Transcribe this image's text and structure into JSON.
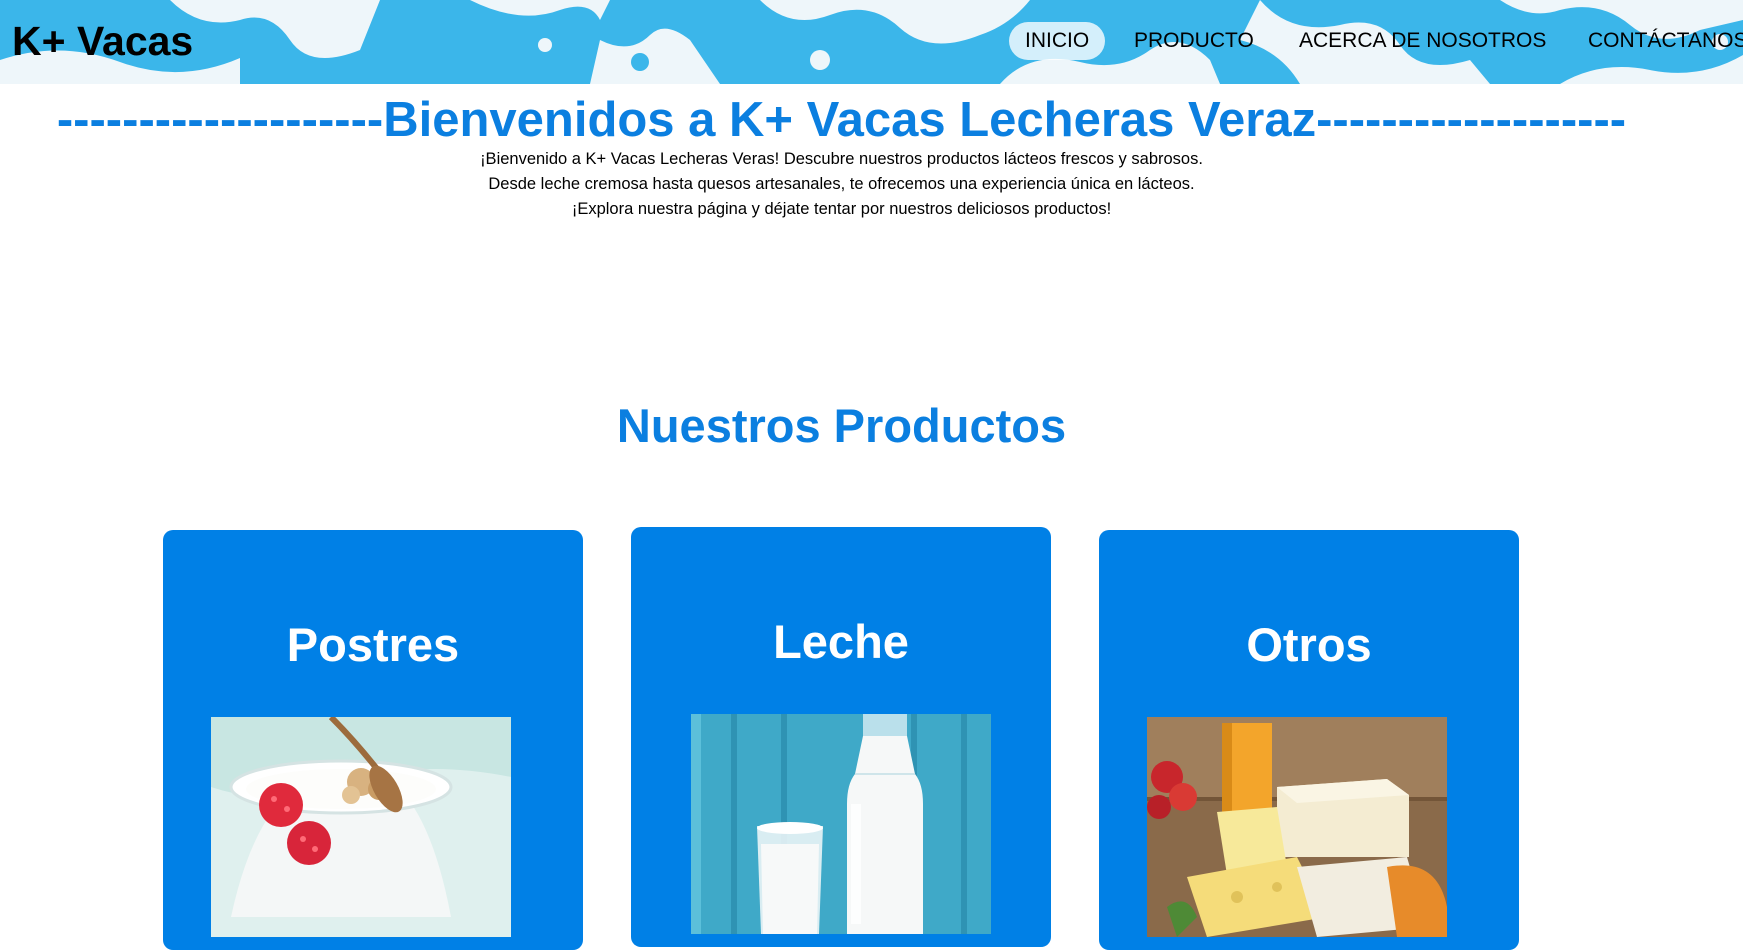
{
  "header": {
    "logo": "K+ Vacas",
    "nav": [
      {
        "label": "INICIO",
        "active": true
      },
      {
        "label": "PRODUCTO",
        "active": false
      },
      {
        "label": "ACERCA DE NOSOTROS",
        "active": false
      },
      {
        "label": "CONTÁCTANOS",
        "active": false
      }
    ]
  },
  "welcome": {
    "title": "--------------------Bienvenidos a K+ Vacas Lecheras Veraz-------------------",
    "lines": [
      "¡Bienvenido a K+ Vacas Lecheras Veras! Descubre nuestros productos lácteos frescos y sabrosos.",
      "Desde leche cremosa hasta quesos artesanales, te ofrecemos una experiencia única en lácteos.",
      "¡Explora nuestra página y déjate tentar por nuestros deliciosos productos!"
    ]
  },
  "products": {
    "title": "Nuestros Productos",
    "cards": [
      {
        "title": "Postres"
      },
      {
        "title": "Leche"
      },
      {
        "title": "Otros"
      }
    ]
  },
  "colors": {
    "accent": "#0b7fe0",
    "card": "#0080e6",
    "header": "#3bb6ea"
  }
}
